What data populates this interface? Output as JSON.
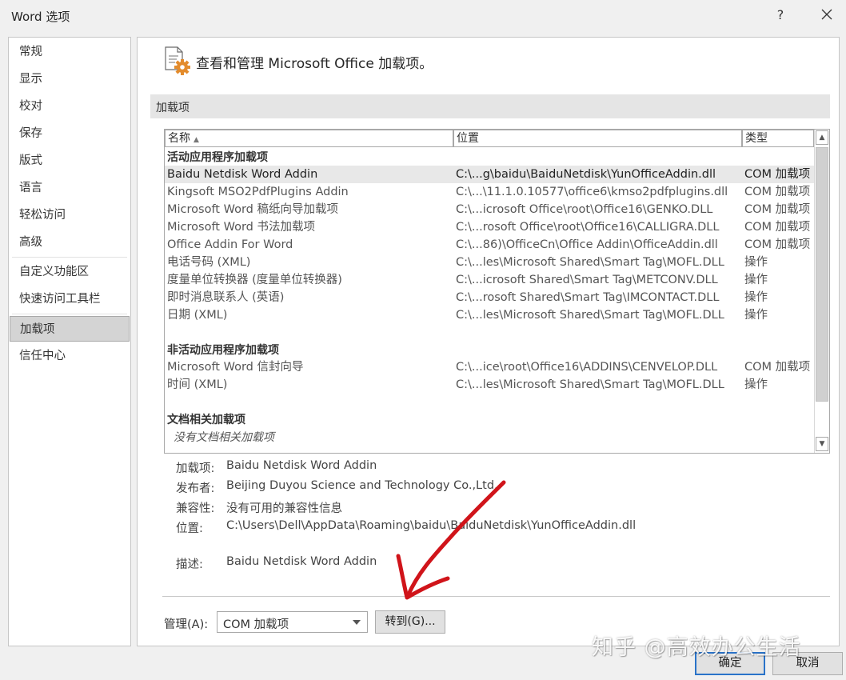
{
  "window": {
    "title": "Word 选项",
    "help_label": "?"
  },
  "sidebar": {
    "items": [
      {
        "label": "常规"
      },
      {
        "label": "显示"
      },
      {
        "label": "校对"
      },
      {
        "label": "保存"
      },
      {
        "label": "版式"
      },
      {
        "label": "语言"
      },
      {
        "label": "轻松访问"
      },
      {
        "label": "高级"
      },
      {
        "label": "自定义功能区"
      },
      {
        "label": "快速访问工具栏"
      },
      {
        "label": "加载项"
      },
      {
        "label": "信任中心"
      }
    ],
    "active": "加载项"
  },
  "header": {
    "title": "查看和管理 Microsoft Office 加载项。",
    "icon": "addin-gear-icon"
  },
  "section": {
    "label": "加载项"
  },
  "list": {
    "columns": {
      "name": "名称",
      "location": "位置",
      "type": "类型"
    },
    "active_group": "活动应用程序加载项",
    "active_items": [
      {
        "name": "Baidu Netdisk Word Addin",
        "location": "C:\\...g\\baidu\\BaiduNetdisk\\YunOfficeAddin.dll",
        "type": "COM 加载项"
      },
      {
        "name": "Kingsoft MSO2PdfPlugins Addin",
        "location": "C:\\...\\11.1.0.10577\\office6\\kmso2pdfplugins.dll",
        "type": "COM 加载项"
      },
      {
        "name": "Microsoft Word 稿纸向导加载项",
        "location": "C:\\...icrosoft Office\\root\\Office16\\GENKO.DLL",
        "type": "COM 加载项"
      },
      {
        "name": "Microsoft Word 书法加载项",
        "location": "C:\\...rosoft Office\\root\\Office16\\CALLIGRA.DLL",
        "type": "COM 加载项"
      },
      {
        "name": "Office Addin For Word",
        "location": "C:\\...86)\\OfficeCn\\Office Addin\\OfficeAddin.dll",
        "type": "COM 加载项"
      },
      {
        "name": "电话号码 (XML)",
        "location": "C:\\...les\\Microsoft Shared\\Smart Tag\\MOFL.DLL",
        "type": "操作"
      },
      {
        "name": "度量单位转换器 (度量单位转换器)",
        "location": "C:\\...icrosoft Shared\\Smart Tag\\METCONV.DLL",
        "type": "操作"
      },
      {
        "name": "即时消息联系人 (英语)",
        "location": "C:\\...rosoft Shared\\Smart Tag\\IMCONTACT.DLL",
        "type": "操作"
      },
      {
        "name": "日期 (XML)",
        "location": "C:\\...les\\Microsoft Shared\\Smart Tag\\MOFL.DLL",
        "type": "操作"
      }
    ],
    "inactive_group": "非活动应用程序加载项",
    "inactive_items": [
      {
        "name": "Microsoft Word 信封向导",
        "location": "C:\\...ice\\root\\Office16\\ADDINS\\CENVELOP.DLL",
        "type": "COM 加载项"
      },
      {
        "name": "时间 (XML)",
        "location": "C:\\...les\\Microsoft Shared\\Smart Tag\\MOFL.DLL",
        "type": "操作"
      }
    ],
    "doc_group": "文档相关加载项",
    "doc_empty": "没有文档相关加载项"
  },
  "details": {
    "addin_label": "加载项:",
    "addin_value": "Baidu Netdisk Word Addin",
    "publisher_label": "发布者:",
    "publisher_value": "Beijing Duyou Science and Technology Co.,Ltd.",
    "compat_label": "兼容性:",
    "compat_value": "没有可用的兼容性信息",
    "location_label": "位置:",
    "location_value": "C:\\Users\\Dell\\AppData\\Roaming\\baidu\\BaiduNetdisk\\YunOfficeAddin.dll",
    "desc_label": "描述:",
    "desc_value": "Baidu Netdisk Word Addin"
  },
  "manage": {
    "label": "管理(A):",
    "selected": "COM 加载项",
    "goto_label": "转到(G)..."
  },
  "buttons": {
    "ok": "确定",
    "cancel": "取消"
  },
  "watermark": "知乎 @高效办公生活",
  "colors": {
    "accent": "#2a73c9",
    "annotation": "#d0141a"
  }
}
